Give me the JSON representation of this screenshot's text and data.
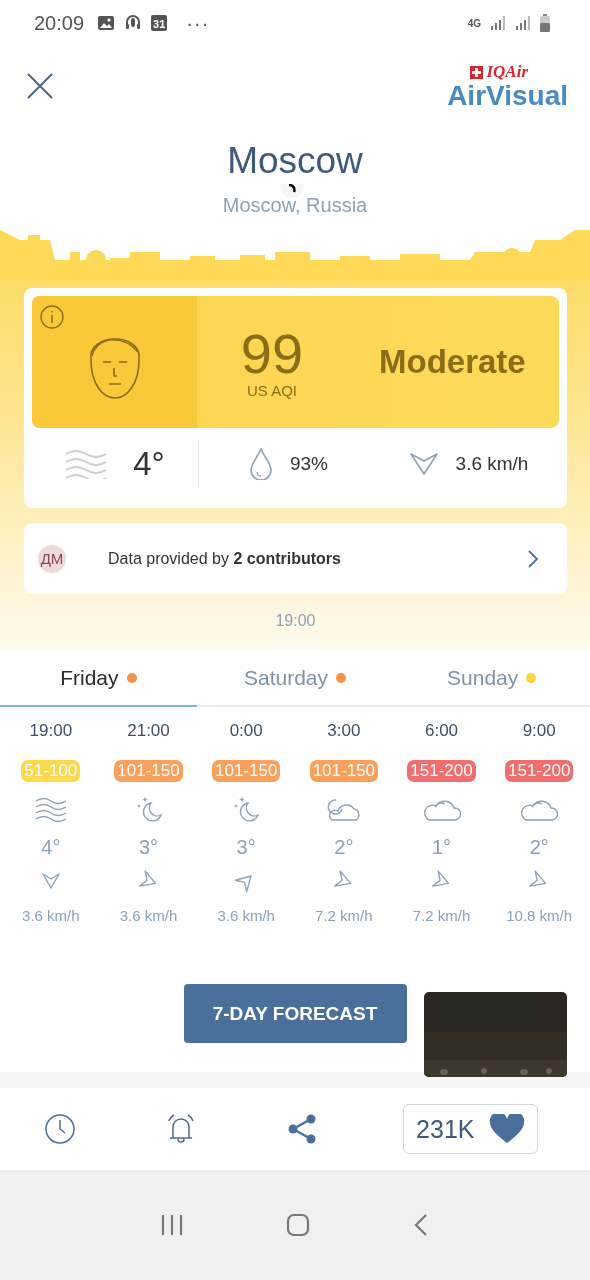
{
  "status_bar": {
    "time": "20:09",
    "calendar_day": "31",
    "more": "···",
    "network": "4G"
  },
  "header": {
    "brand_top": "IQAir",
    "brand": "AirVisual"
  },
  "location": {
    "city": "Moscow",
    "region": "Moscow, Russia",
    "loading": true
  },
  "aqi": {
    "value": "99",
    "unit": "US AQI",
    "status": "Moderate"
  },
  "weather": {
    "temperature": "4°",
    "humidity": "93%",
    "wind": "3.6 km/h"
  },
  "contributors": {
    "logo": "ДМ",
    "text": "Data provided by **2 contributors**"
  },
  "updated": "19:00",
  "tabs": [
    {
      "label": "Friday",
      "selected": true,
      "color": "#f7924a"
    },
    {
      "label": "Saturday",
      "selected": false,
      "color": "#f7924a"
    },
    {
      "label": "Sunday",
      "selected": false,
      "color": "#fbd440"
    }
  ],
  "hourly": [
    {
      "time": "19:00",
      "aqi": "51-100",
      "color": "#fdd84e",
      "kind": "wind",
      "temperature": "4°",
      "arrow": {
        "kind": "south"
      },
      "wind": "3.6 km/h"
    },
    {
      "time": "21:00",
      "aqi": "101-150",
      "color": "#f9a15c",
      "kind": "moon",
      "temperature": "3°",
      "arrow": {
        "kind": "east"
      },
      "wind": "3.6 km/h"
    },
    {
      "time": "0:00",
      "aqi": "101-150",
      "color": "#f9a15c",
      "kind": "moon",
      "temperature": "3°",
      "arrow": {
        "kind": "northeast"
      },
      "wind": "3.6 km/h"
    },
    {
      "time": "3:00",
      "aqi": "101-150",
      "color": "#f9a15c",
      "kind": "cloud-moon",
      "temperature": "2°",
      "arrow": {
        "kind": "east"
      },
      "wind": "7.2 km/h"
    },
    {
      "time": "6:00",
      "aqi": "151-200",
      "color": "#f26d6d",
      "kind": "cloud",
      "temperature": "1°",
      "arrow": {
        "kind": "east"
      },
      "wind": "7.2 km/h"
    },
    {
      "time": "9:00",
      "aqi": "151-200",
      "color": "#f26d6d",
      "kind": "cloud",
      "temperature": "2°",
      "arrow": {
        "kind": "east"
      },
      "wind": "10.8 km/h"
    }
  ],
  "forecast_button": "7-DAY FORECAST",
  "likes": "231K"
}
